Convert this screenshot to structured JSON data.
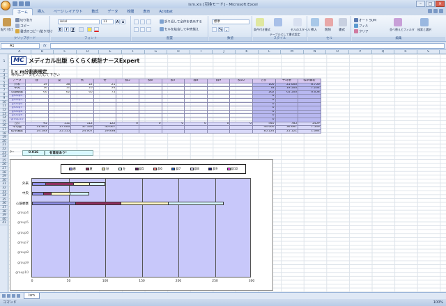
{
  "window": {
    "title": "lsm.xls [互換モード] - Microsoft Excel"
  },
  "tabs": [
    "ホーム",
    "挿入",
    "ページ レイアウト",
    "数式",
    "データ",
    "校閲",
    "表示",
    "Acrobat"
  ],
  "ribbon": {
    "clipboard": {
      "paste": "貼り付け",
      "cut": "切り取り",
      "copy": "コピー",
      "format_painter": "書式のコピー/貼り付け",
      "label": "クリップボード"
    },
    "font": {
      "name": "Arial",
      "size": "11",
      "label": "フォント",
      "bold": "B",
      "italic": "I",
      "underline": "U",
      "grow": "A",
      "shrink": "A"
    },
    "alignment": {
      "wrap": "折り返して全体を表示する",
      "merge": "セルを結合して中央揃え",
      "label": "配置"
    },
    "number": {
      "format": "標準",
      "percent": "%",
      "comma": ",",
      "label": "数値"
    },
    "styles": {
      "conditional": "条件付き書式",
      "table": "テーブルとして書式設定",
      "cell": "セルのスタイル",
      "label": "スタイル"
    },
    "cells": {
      "insert": "挿入",
      "delete": "削除",
      "format": "書式",
      "label": "セル"
    },
    "editing": {
      "autosum": "オート SUM",
      "fill": "フィル",
      "clear": "クリア",
      "sort": "並べ替えとフィルタ",
      "find": "検索と選択",
      "label": "編集"
    }
  },
  "formula_bar": {
    "name_box": "A1",
    "fx": "fx"
  },
  "columns": [
    "A",
    "B",
    "C",
    "D",
    "E",
    "F",
    "G",
    "H",
    "I",
    "J",
    "K",
    "L",
    "M",
    "N",
    "O",
    "P",
    "Q",
    "R",
    "S",
    "T"
  ],
  "rows": [
    "1",
    "2",
    "3",
    "4",
    "5",
    "6",
    "7",
    "8",
    "9",
    "10",
    "11",
    "12",
    "13",
    "14",
    "15",
    "16",
    "17",
    "18",
    "19",
    "20",
    "21",
    "22",
    "23",
    "24",
    "25",
    "26",
    "27",
    "28",
    "29",
    "30",
    "31",
    "32",
    "33",
    "34",
    "35",
    "36",
    "37",
    "38",
    "39",
    "40",
    "41"
  ],
  "sheet": {
    "logo": "MC",
    "brand": "メディカル出版 らくらく統計ナースExpert",
    "title": "l × m分割表検定",
    "note": "枠内にデータを入力して下さい",
    "table": {
      "header": [
        "データ",
        "春",
        "夏",
        "秋",
        "冬",
        "群5",
        "群6",
        "群7",
        "群8",
        "群9",
        "群10",
        "合計",
        "平均値",
        "標準偏差"
      ],
      "rows": [
        [
          "外来",
          "19",
          "38",
          "22",
          "21",
          "",
          "",
          "",
          "",
          "",
          "",
          "100",
          "25.000",
          "8.756"
        ],
        [
          "中央",
          "16",
          "11",
          "25",
          "26",
          "",
          "",
          "",
          "",
          "",
          "",
          "78",
          "19.500",
          "7.234"
        ],
        [
          "心筋梗塞",
          "60",
          "62",
          "65",
          "75",
          "",
          "",
          "",
          "",
          "",
          "",
          "262",
          "65.500",
          "6.658"
        ],
        [
          "group4",
          "",
          "",
          "",
          "",
          "",
          "",
          "",
          "",
          "",
          "",
          "0",
          "",
          ""
        ],
        [
          "group5",
          "",
          "",
          "",
          "",
          "",
          "",
          "",
          "",
          "",
          "",
          "0",
          "",
          ""
        ],
        [
          "group6",
          "",
          "",
          "",
          "",
          "",
          "",
          "",
          "",
          "",
          "",
          "0",
          "",
          ""
        ],
        [
          "group7",
          "",
          "",
          "",
          "",
          "",
          "",
          "",
          "",
          "",
          "",
          "0",
          "",
          ""
        ],
        [
          "group8",
          "",
          "",
          "",
          "",
          "",
          "",
          "",
          "",
          "",
          "",
          "0",
          "",
          ""
        ],
        [
          "group9",
          "",
          "",
          "",
          "",
          "",
          "",
          "",
          "",
          "",
          "",
          "0",
          "",
          ""
        ],
        [
          "group10",
          "",
          "",
          "",
          "",
          "",
          "",
          "",
          "",
          "",
          "",
          "0",
          "",
          ""
        ]
      ],
      "totals": [
        [
          "合計",
          "95",
          "111",
          "112",
          "122",
          "0",
          "0",
          "0",
          "0",
          "0",
          "0",
          "440",
          "785",
          "1459"
        ],
        [
          "平均値",
          "31.667",
          "37.000",
          "37.333",
          "40.667",
          "",
          "",
          "",
          "",
          "",
          "",
          "44.000",
          "36.667",
          "7.549"
        ],
        [
          "標準偏差",
          "24.583",
          "25.515",
          "24.007",
          "29.838",
          "",
          "",
          "",
          "",
          "",
          "",
          "85.224",
          "25.121",
          "1.084"
        ]
      ]
    },
    "p_label": "p=",
    "p_value": "0.016",
    "result": "有意差あり*"
  },
  "chart_data": {
    "type": "bar",
    "stacked": true,
    "orientation": "horizontal",
    "categories": [
      "外来",
      "中央",
      "心筋梗塞",
      "group4",
      "group5",
      "group6",
      "group7",
      "group8",
      "group9",
      "group10"
    ],
    "series": [
      {
        "name": "春",
        "values": [
          19,
          16,
          60,
          0,
          0,
          0,
          0,
          0,
          0,
          0
        ],
        "color": "#8f8fe8"
      },
      {
        "name": "夏",
        "values": [
          38,
          11,
          62,
          0,
          0,
          0,
          0,
          0,
          0,
          0
        ],
        "color": "#8f2f5f"
      },
      {
        "name": "秋",
        "values": [
          22,
          25,
          65,
          0,
          0,
          0,
          0,
          0,
          0,
          0
        ],
        "color": "#fff8c8"
      },
      {
        "name": "冬",
        "values": [
          21,
          26,
          75,
          0,
          0,
          0,
          0,
          0,
          0,
          0
        ],
        "color": "#d8f8ff"
      },
      {
        "name": "群5",
        "values": [
          0,
          0,
          0,
          0,
          0,
          0,
          0,
          0,
          0,
          0
        ],
        "color": "#5a1a5a"
      },
      {
        "name": "群6",
        "values": [
          0,
          0,
          0,
          0,
          0,
          0,
          0,
          0,
          0,
          0
        ],
        "color": "#f08080"
      },
      {
        "name": "群7",
        "values": [
          0,
          0,
          0,
          0,
          0,
          0,
          0,
          0,
          0,
          0
        ],
        "color": "#2060c0"
      },
      {
        "name": "群8",
        "values": [
          0,
          0,
          0,
          0,
          0,
          0,
          0,
          0,
          0,
          0
        ],
        "color": "#d0d0f8"
      },
      {
        "name": "群9",
        "values": [
          0,
          0,
          0,
          0,
          0,
          0,
          0,
          0,
          0,
          0
        ],
        "color": "#20208a"
      },
      {
        "name": "群10",
        "values": [
          0,
          0,
          0,
          0,
          0,
          0,
          0,
          0,
          0,
          0
        ],
        "color": "#e040e0"
      }
    ],
    "xlim": [
      0,
      300
    ],
    "xticks": [
      "0",
      "50",
      "100",
      "150",
      "200",
      "250",
      "300"
    ],
    "grid": true,
    "legend": "top"
  },
  "sheet_tabs": [
    "lsm"
  ],
  "status": {
    "mode": "コマンド",
    "zoom": "100%"
  }
}
